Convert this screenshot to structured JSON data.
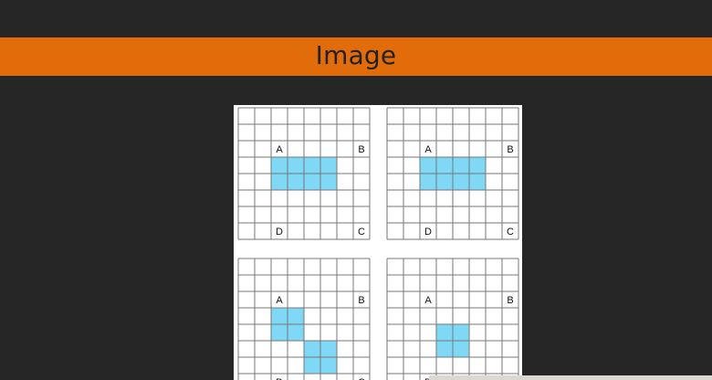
{
  "header": {
    "title": "Image"
  },
  "figure": {
    "grid_size": [
      8,
      8
    ],
    "shade_color": "#7fd8f6",
    "line_color": "#777777",
    "panels": [
      {
        "name": "grid-top-left",
        "labels": [
          "A",
          "B",
          "C",
          "D"
        ],
        "shaded_cells": [
          [
            2,
            3
          ],
          [
            2,
            4
          ],
          [
            3,
            3
          ],
          [
            3,
            4
          ],
          [
            4,
            3
          ],
          [
            4,
            4
          ],
          [
            5,
            3
          ],
          [
            5,
            4
          ]
        ]
      },
      {
        "name": "grid-top-right",
        "labels": [
          "A",
          "B",
          "C",
          "D"
        ],
        "shaded_cells": [
          [
            2,
            3
          ],
          [
            3,
            3
          ],
          [
            4,
            3
          ],
          [
            5,
            3
          ],
          [
            2,
            4
          ],
          [
            3,
            4
          ],
          [
            4,
            4
          ],
          [
            5,
            4
          ]
        ]
      },
      {
        "name": "grid-bottom-left",
        "labels": [
          "A",
          "B",
          "C",
          "D"
        ],
        "shaded_cells": [
          [
            2,
            3
          ],
          [
            3,
            3
          ],
          [
            2,
            4
          ],
          [
            3,
            4
          ],
          [
            4,
            5
          ],
          [
            5,
            5
          ],
          [
            4,
            6
          ],
          [
            5,
            6
          ]
        ]
      },
      {
        "name": "grid-bottom-right",
        "labels": [
          "A",
          "B",
          "C",
          "D"
        ],
        "shaded_cells": [
          [
            3,
            4
          ],
          [
            4,
            4
          ],
          [
            3,
            5
          ],
          [
            4,
            5
          ]
        ]
      }
    ]
  }
}
